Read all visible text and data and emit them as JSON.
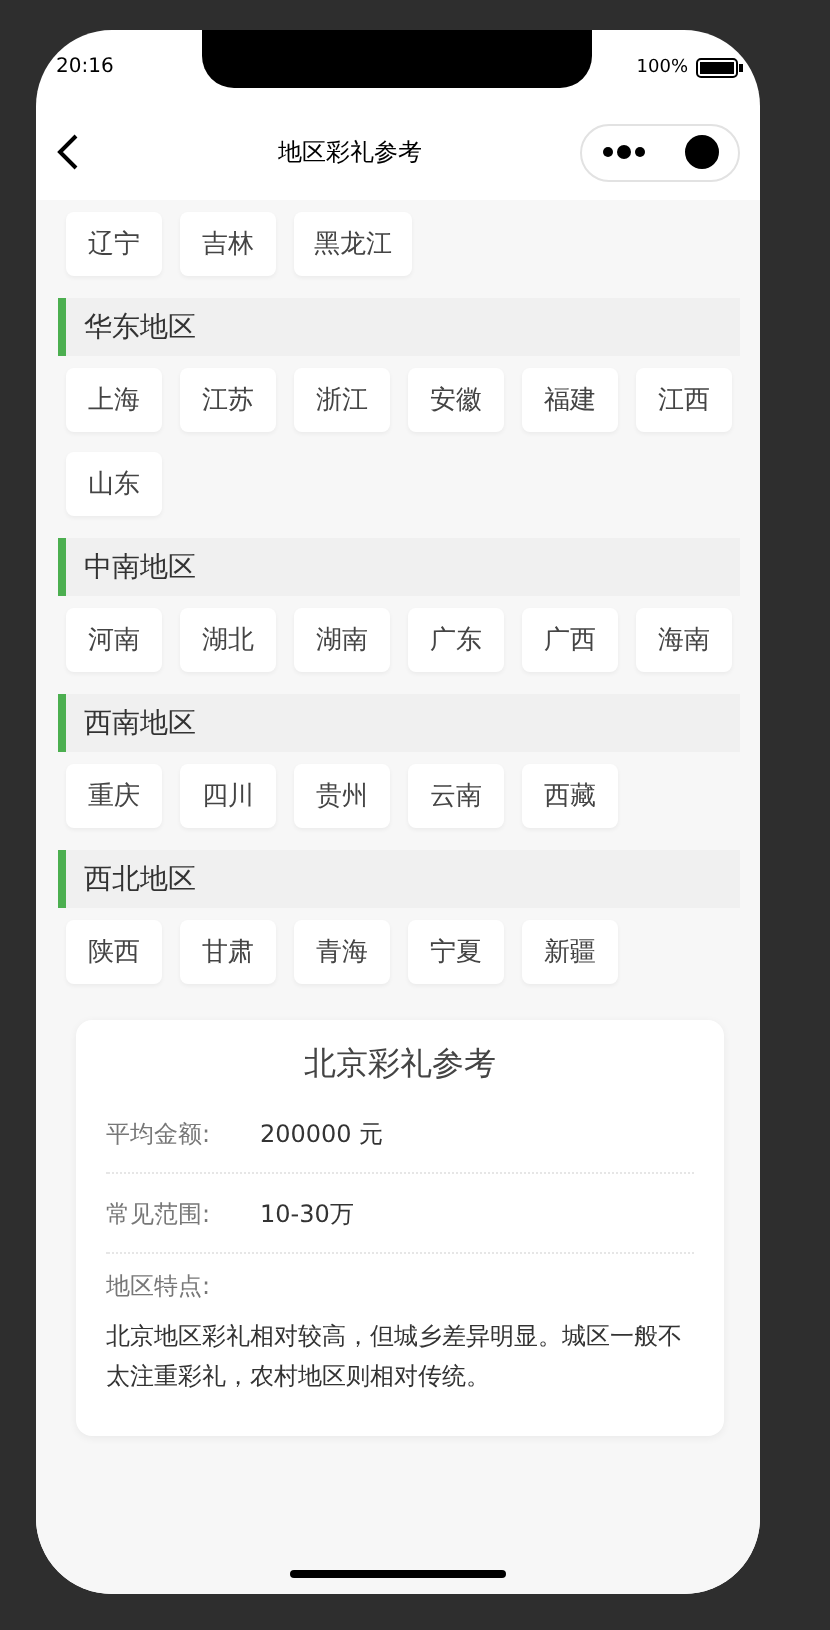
{
  "status_bar": {
    "time": "20:16",
    "battery": "100%"
  },
  "nav": {
    "title": "地区彩礼参考"
  },
  "top_provinces": [
    "辽宁",
    "吉林",
    "黑龙江"
  ],
  "regions": [
    {
      "name": "华东地区",
      "provinces": [
        "上海",
        "江苏",
        "浙江",
        "安徽",
        "福建",
        "江西",
        "山东"
      ]
    },
    {
      "name": "中南地区",
      "provinces": [
        "河南",
        "湖北",
        "湖南",
        "广东",
        "广西",
        "海南"
      ]
    },
    {
      "name": "西南地区",
      "provinces": [
        "重庆",
        "四川",
        "贵州",
        "云南",
        "西藏"
      ]
    },
    {
      "name": "西北地区",
      "provinces": [
        "陕西",
        "甘肃",
        "青海",
        "宁夏",
        "新疆"
      ]
    }
  ],
  "detail": {
    "title": "北京彩礼参考",
    "rows": [
      {
        "label": "平均金额:",
        "value": "200000 元"
      },
      {
        "label": "常见范围:",
        "value": "10-30万"
      }
    ],
    "feature_label": "地区特点:",
    "feature_text": "北京地区彩礼相对较高，但城乡差异明显。城区一般不太注重彩礼，农村地区则相对传统。"
  }
}
